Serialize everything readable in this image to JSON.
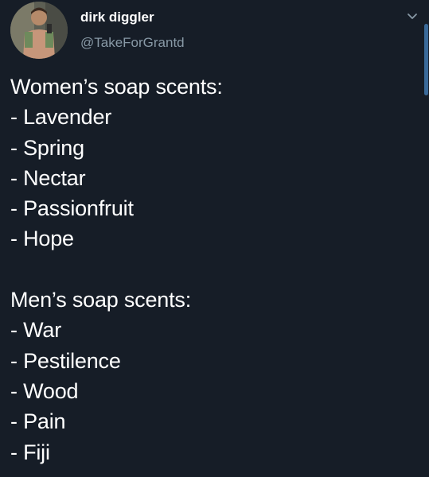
{
  "author": {
    "display_name": "dirk diggler",
    "handle": "@TakeForGrantd"
  },
  "icons": {
    "avatar": "profile-photo",
    "menu": "chevron-down-icon"
  },
  "colors": {
    "background": "#161d27",
    "text": "#ffffff",
    "secondary_text": "#8899a6",
    "scrollbar": "#3a6a9a"
  },
  "tweet": {
    "womens_heading": "Women’s soap scents:",
    "womens_items": [
      "- Lavender",
      "- Spring",
      "- Nectar",
      "- Passionfruit",
      "- Hope"
    ],
    "mens_heading": "Men’s soap scents:",
    "mens_items": [
      "- War",
      "- Pestilence",
      "- Wood",
      "- Pain",
      "- Fiji"
    ]
  }
}
